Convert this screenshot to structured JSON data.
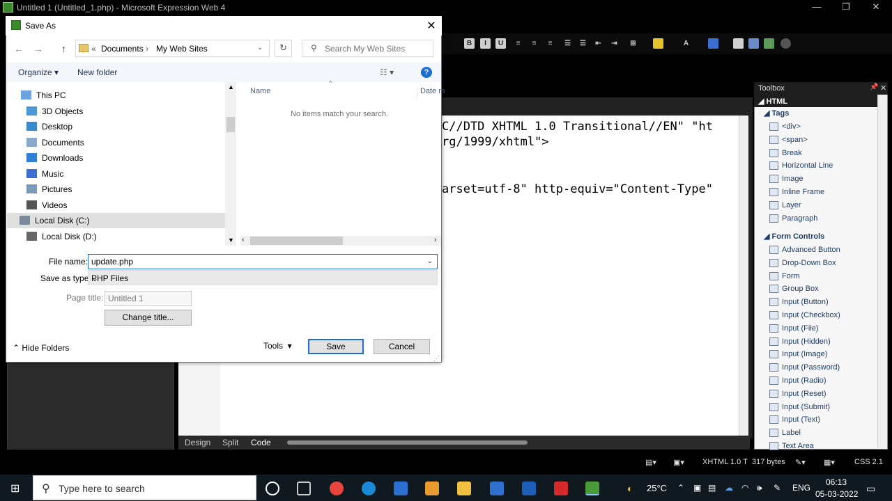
{
  "app": {
    "title": "Untitled 1 (Untitled_1.php) - Microsoft Expression Web 4",
    "code_lines": [
      "C//DTD XHTML 1.0 Transitional//EN\" \"ht",
      "rg/1999/xhtml\">",
      "arset=utf-8\" http-equiv=\"Content-Type\""
    ],
    "view_tabs": [
      "Design",
      "Split",
      "Code"
    ],
    "status": {
      "doctype": "XHTML 1.0 T",
      "size": "317 bytes",
      "css": "CSS 2.1"
    }
  },
  "toolbox": {
    "title": "Toolbox",
    "section": "HTML",
    "tags_label": "Tags",
    "tags": [
      "<div>",
      "<span>",
      "Break",
      "Horizontal Line",
      "Image",
      "Inline Frame",
      "Layer",
      "Paragraph"
    ],
    "forms_label": "Form Controls",
    "forms": [
      "Advanced Button",
      "Drop-Down Box",
      "Form",
      "Group Box",
      "Input (Button)",
      "Input (Checkbox)",
      "Input (File)",
      "Input (Hidden)",
      "Input (Image)",
      "Input (Password)",
      "Input (Radio)",
      "Input (Reset)",
      "Input (Submit)",
      "Input (Text)",
      "Label",
      "Text Area"
    ]
  },
  "dialog": {
    "title": "Save As",
    "breadcrumb": [
      "Documents",
      "My Web Sites"
    ],
    "search_placeholder": "Search My Web Sites",
    "organize": "Organize",
    "new_folder": "New folder",
    "nav_items": [
      "This PC",
      "3D Objects",
      "Desktop",
      "Documents",
      "Downloads",
      "Music",
      "Pictures",
      "Videos",
      "Local Disk (C:)",
      "Local Disk (D:)"
    ],
    "col_name": "Name",
    "col_date": "Date m",
    "empty_message": "No items match your search.",
    "file_name_label": "File name:",
    "file_name_value": "update.php",
    "save_type_label": "Save as type:",
    "save_type_value": "PHP Files",
    "page_title_label": "Page title:",
    "page_title_value": "Untitled 1",
    "change_title": "Change title...",
    "hide_folders": "Hide Folders",
    "tools": "Tools",
    "save": "Save",
    "cancel": "Cancel"
  },
  "taskbar": {
    "search_placeholder": "Type here to search",
    "weather": "25°C",
    "language": "ENG",
    "time": "06:13",
    "date": "05-03-2022"
  }
}
